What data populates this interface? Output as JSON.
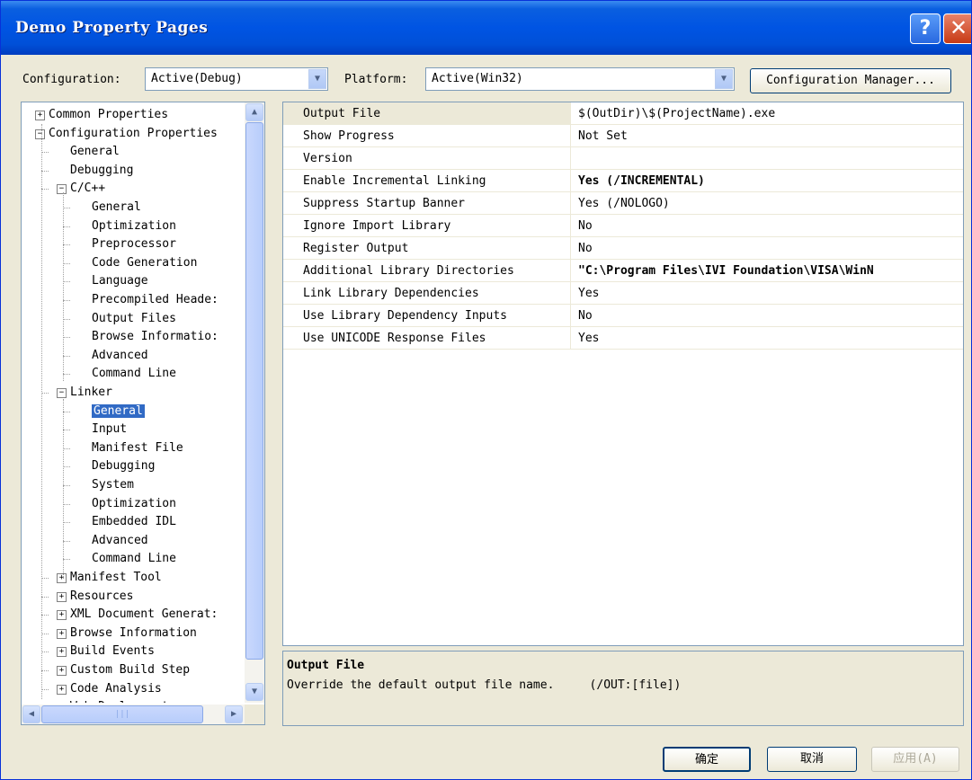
{
  "window": {
    "title": "Demo Property Pages",
    "help_glyph": "?",
    "close_glyph": "✕"
  },
  "config_bar": {
    "configuration_label": "Configuration:",
    "configuration_value": "Active(Debug)",
    "platform_label": "Platform:",
    "platform_value": "Active(Win32)",
    "manager_button": "Configuration Manager..."
  },
  "tree": [
    {
      "label": "Common Properties",
      "level": 0,
      "expander": "+"
    },
    {
      "label": "Configuration Properties",
      "level": 0,
      "expander": "−"
    },
    {
      "label": "General",
      "level": 1
    },
    {
      "label": "Debugging",
      "level": 1
    },
    {
      "label": "C/C++",
      "level": 1,
      "expander": "−"
    },
    {
      "label": "General",
      "level": 2
    },
    {
      "label": "Optimization",
      "level": 2
    },
    {
      "label": "Preprocessor",
      "level": 2
    },
    {
      "label": "Code Generation",
      "level": 2
    },
    {
      "label": "Language",
      "level": 2
    },
    {
      "label": "Precompiled Heade:",
      "level": 2
    },
    {
      "label": "Output Files",
      "level": 2
    },
    {
      "label": "Browse Informatio:",
      "level": 2
    },
    {
      "label": "Advanced",
      "level": 2
    },
    {
      "label": "Command Line",
      "level": 2
    },
    {
      "label": "Linker",
      "level": 1,
      "expander": "−"
    },
    {
      "label": "General",
      "level": 2,
      "selected": true
    },
    {
      "label": "Input",
      "level": 2
    },
    {
      "label": "Manifest File",
      "level": 2
    },
    {
      "label": "Debugging",
      "level": 2
    },
    {
      "label": "System",
      "level": 2
    },
    {
      "label": "Optimization",
      "level": 2
    },
    {
      "label": "Embedded IDL",
      "level": 2
    },
    {
      "label": "Advanced",
      "level": 2
    },
    {
      "label": "Command Line",
      "level": 2
    },
    {
      "label": "Manifest Tool",
      "level": 1,
      "expander": "+"
    },
    {
      "label": "Resources",
      "level": 1,
      "expander": "+"
    },
    {
      "label": "XML Document Generat:",
      "level": 1,
      "expander": "+"
    },
    {
      "label": "Browse Information",
      "level": 1,
      "expander": "+"
    },
    {
      "label": "Build Events",
      "level": 1,
      "expander": "+"
    },
    {
      "label": "Custom Build Step",
      "level": 1,
      "expander": "+"
    },
    {
      "label": "Code Analysis",
      "level": 1,
      "expander": "+"
    },
    {
      "label": "Web Deployment",
      "level": 1,
      "expander": "+"
    }
  ],
  "tree_scroll": {
    "up": "▲",
    "down": "▼",
    "left": "◀",
    "right": "▶",
    "grip": "|||"
  },
  "properties": [
    {
      "name": "Output File",
      "value": "$(OutDir)\\$(ProjectName).exe",
      "bold": false
    },
    {
      "name": "Show Progress",
      "value": "Not Set",
      "bold": false
    },
    {
      "name": "Version",
      "value": "",
      "bold": false
    },
    {
      "name": "Enable Incremental Linking",
      "value": "Yes (/INCREMENTAL)",
      "bold": true
    },
    {
      "name": "Suppress Startup Banner",
      "value": "Yes (/NOLOGO)",
      "bold": false
    },
    {
      "name": "Ignore Import Library",
      "value": "No",
      "bold": false
    },
    {
      "name": "Register Output",
      "value": "No",
      "bold": false
    },
    {
      "name": "Additional Library Directories",
      "value": "\"C:\\Program Files\\IVI Foundation\\VISA\\WinN",
      "bold": true
    },
    {
      "name": "Link Library Dependencies",
      "value": "Yes",
      "bold": false
    },
    {
      "name": "Use Library Dependency Inputs",
      "value": "No",
      "bold": false
    },
    {
      "name": "Use UNICODE Response Files",
      "value": "Yes",
      "bold": false
    }
  ],
  "description": {
    "title": "Output File",
    "text": "Override the default output file name.     (/OUT:[file])"
  },
  "buttons": {
    "ok": "确定",
    "cancel": "取消",
    "apply": "应用(A)"
  },
  "colors": {
    "titlebar": "#0054e3",
    "selection": "#316ac5",
    "dialog_bg": "#ece9d8"
  }
}
